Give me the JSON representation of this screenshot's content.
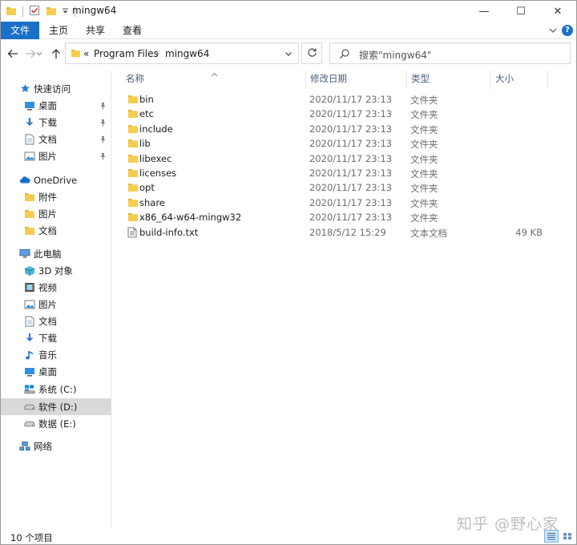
{
  "window": {
    "title": "mingw64",
    "controls": {
      "minimize": "—",
      "maximize": "☐",
      "close": "✕"
    }
  },
  "ribbon": {
    "tabs": [
      {
        "label": "文件"
      },
      {
        "label": "主页"
      },
      {
        "label": "共享"
      },
      {
        "label": "查看"
      }
    ]
  },
  "address": {
    "overflow": "«",
    "segments": [
      "Program Files",
      "mingw64"
    ],
    "separator": "›"
  },
  "search": {
    "placeholder": "搜索\"mingw64\""
  },
  "sidebar": {
    "items": [
      {
        "label": "快速访问",
        "icon": "star-icon",
        "level": 0
      },
      {
        "label": "桌面",
        "icon": "desktop-icon",
        "level": 1,
        "pinned": true
      },
      {
        "label": "下载",
        "icon": "download-icon",
        "level": 1,
        "pinned": true
      },
      {
        "label": "文档",
        "icon": "document-icon",
        "level": 1,
        "pinned": true
      },
      {
        "label": "图片",
        "icon": "picture-icon",
        "level": 1,
        "pinned": true
      },
      {
        "label": "OneDrive",
        "icon": "cloud-icon",
        "level": 0
      },
      {
        "label": "附件",
        "icon": "folder-icon",
        "level": 1
      },
      {
        "label": "图片",
        "icon": "folder-icon",
        "level": 1
      },
      {
        "label": "文档",
        "icon": "folder-icon",
        "level": 1
      },
      {
        "label": "此电脑",
        "icon": "computer-icon",
        "level": 0
      },
      {
        "label": "3D 对象",
        "icon": "cube-icon",
        "level": 1
      },
      {
        "label": "视频",
        "icon": "video-icon",
        "level": 1
      },
      {
        "label": "图片",
        "icon": "picture-icon",
        "level": 1
      },
      {
        "label": "文档",
        "icon": "document-icon",
        "level": 1
      },
      {
        "label": "下载",
        "icon": "download-icon",
        "level": 1
      },
      {
        "label": "音乐",
        "icon": "music-icon",
        "level": 1
      },
      {
        "label": "桌面",
        "icon": "desktop-icon",
        "level": 1
      },
      {
        "label": "系统 (C:)",
        "icon": "system-drive-icon",
        "level": 1
      },
      {
        "label": "软件 (D:)",
        "icon": "drive-icon",
        "level": 1,
        "selected": true
      },
      {
        "label": "数据 (E:)",
        "icon": "drive-icon",
        "level": 1
      },
      {
        "label": "网络",
        "icon": "network-icon",
        "level": 0
      }
    ]
  },
  "columns": {
    "name": "名称",
    "modified": "修改日期",
    "type": "类型",
    "size": "大小"
  },
  "files": [
    {
      "name": "bin",
      "modified": "2020/11/17 23:13",
      "type": "文件夹",
      "size": "",
      "icon": "folder-icon"
    },
    {
      "name": "etc",
      "modified": "2020/11/17 23:13",
      "type": "文件夹",
      "size": "",
      "icon": "folder-icon"
    },
    {
      "name": "include",
      "modified": "2020/11/17 23:13",
      "type": "文件夹",
      "size": "",
      "icon": "folder-icon"
    },
    {
      "name": "lib",
      "modified": "2020/11/17 23:13",
      "type": "文件夹",
      "size": "",
      "icon": "folder-icon"
    },
    {
      "name": "libexec",
      "modified": "2020/11/17 23:13",
      "type": "文件夹",
      "size": "",
      "icon": "folder-icon"
    },
    {
      "name": "licenses",
      "modified": "2020/11/17 23:13",
      "type": "文件夹",
      "size": "",
      "icon": "folder-icon"
    },
    {
      "name": "opt",
      "modified": "2020/11/17 23:13",
      "type": "文件夹",
      "size": "",
      "icon": "folder-icon"
    },
    {
      "name": "share",
      "modified": "2020/11/17 23:13",
      "type": "文件夹",
      "size": "",
      "icon": "folder-icon"
    },
    {
      "name": "x86_64-w64-mingw32",
      "modified": "2020/11/17 23:13",
      "type": "文件夹",
      "size": "",
      "icon": "folder-icon"
    },
    {
      "name": "build-info.txt",
      "modified": "2018/5/12 15:29",
      "type": "文本文档",
      "size": "49 KB",
      "icon": "text-file-icon"
    }
  ],
  "status": {
    "count": "10 个项目"
  },
  "watermark": "知乎 @野心家",
  "colors": {
    "accent": "#1a6fc9",
    "folder": "#e8b833",
    "selection": "#d9d9d9"
  }
}
